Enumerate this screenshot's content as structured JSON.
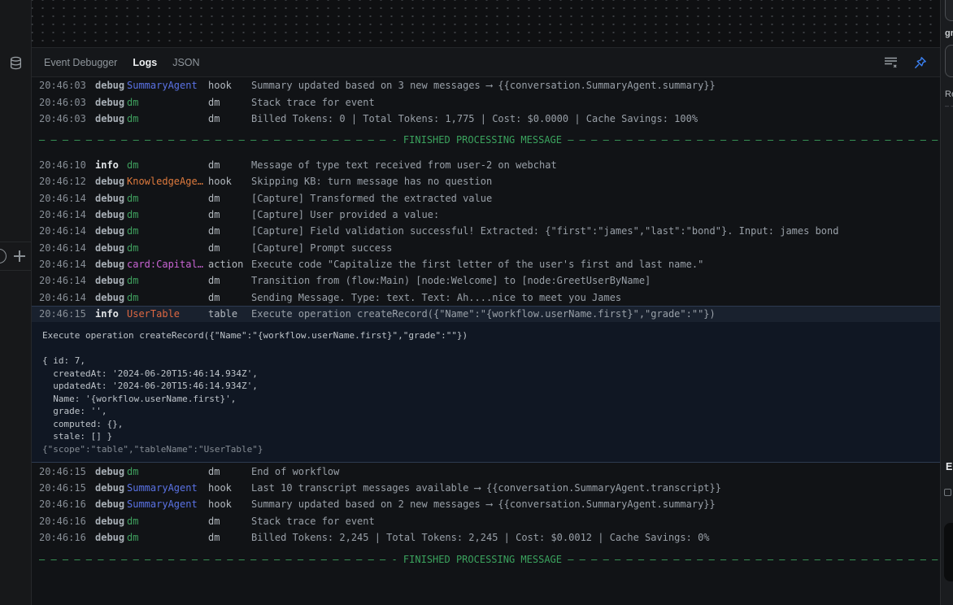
{
  "tabs": [
    {
      "id": "event-debugger",
      "label": "Event Debugger",
      "active": false
    },
    {
      "id": "logs",
      "label": "Logs",
      "active": true
    },
    {
      "id": "json",
      "label": "JSON",
      "active": false
    }
  ],
  "icons": {
    "database": "database-icon",
    "circle_partial": "circle-icon",
    "plus": "plus-icon",
    "clear_logs": "clear-logs-icon",
    "pin": "pin-icon"
  },
  "palette": {
    "blue": "#5a72e4",
    "green": "#3fa05e",
    "orange": "#de7a3d",
    "magenta": "#c964d4",
    "red": "#dd6742",
    "separator_green": "#3ba35e",
    "pin_blue": "#3b82f6",
    "selected_row_bg": "#19212e"
  },
  "separator": {
    "label": "FINISHED PROCESSING MESSAGE",
    "dash": "— ",
    "left_repeat": 30,
    "left_tail": "- ",
    "right_repeat": 40
  },
  "logs": {
    "rows": [
      {
        "type": "log",
        "time": "20:46:03",
        "level": "debug",
        "agent": "SummaryAgent",
        "agent_color": "blue",
        "category": "hook",
        "message": "Summary updated based on 3 new messages ⟶ {{conversation.SummaryAgent.summary}}"
      },
      {
        "type": "log",
        "time": "20:46:03",
        "level": "debug",
        "agent": "dm",
        "agent_color": "green",
        "category": "dm",
        "message": "Stack trace for event"
      },
      {
        "type": "log",
        "time": "20:46:03",
        "level": "debug",
        "agent": "dm",
        "agent_color": "green",
        "category": "dm",
        "message": "Billed Tokens: 0 | Total Tokens: 1,775 | Cost: $0.0000 | Cache Savings: 100%"
      },
      {
        "type": "gap",
        "size": "small"
      },
      {
        "type": "separator"
      },
      {
        "type": "gap",
        "size": "large"
      },
      {
        "type": "log",
        "time": "20:46:10",
        "level": "info",
        "agent": "dm",
        "agent_color": "green",
        "category": "dm",
        "message": "Message of type text received from user-2 on webchat"
      },
      {
        "type": "log",
        "time": "20:46:12",
        "level": "debug",
        "agent": "KnowledgeAge…",
        "agent_color": "orange",
        "category": "hook",
        "message": "Skipping KB: turn message has no question"
      },
      {
        "type": "log",
        "time": "20:46:14",
        "level": "debug",
        "agent": "dm",
        "agent_color": "green",
        "category": "dm",
        "message": "[Capture] Transformed the extracted value"
      },
      {
        "type": "log",
        "time": "20:46:14",
        "level": "debug",
        "agent": "dm",
        "agent_color": "green",
        "category": "dm",
        "message": "[Capture] User provided a value:"
      },
      {
        "type": "log",
        "time": "20:46:14",
        "level": "debug",
        "agent": "dm",
        "agent_color": "green",
        "category": "dm",
        "message": "[Capture] Field validation successful! Extracted: {\"first\":\"james\",\"last\":\"bond\"}. Input: james bond"
      },
      {
        "type": "log",
        "time": "20:46:14",
        "level": "debug",
        "agent": "dm",
        "agent_color": "green",
        "category": "dm",
        "message": "[Capture] Prompt success"
      },
      {
        "type": "log",
        "time": "20:46:14",
        "level": "debug",
        "agent": "card:Capital…",
        "agent_color": "magenta",
        "category": "action",
        "message": "Execute code \"Capitalize the first letter of the user's first and last name.\""
      },
      {
        "type": "log",
        "time": "20:46:14",
        "level": "debug",
        "agent": "dm",
        "agent_color": "green",
        "category": "dm",
        "message": "Transition from (flow:Main) [node:Welcome] to [node:GreetUserByName]"
      },
      {
        "type": "log",
        "time": "20:46:14",
        "level": "debug",
        "agent": "dm",
        "agent_color": "green",
        "category": "dm",
        "message": "Sending Message. Type: text. Text: Ah....nice to meet you James"
      },
      {
        "type": "log",
        "selected": true,
        "time": "20:46:15",
        "level": "info",
        "agent": "UserTable",
        "agent_color": "red",
        "category": "table",
        "message": "Execute operation createRecord({\"Name\":\"{workflow.userName.first}\",\"grade\":\"\"})"
      },
      {
        "type": "expanded"
      },
      {
        "type": "log",
        "time": "20:46:15",
        "level": "debug",
        "agent": "dm",
        "agent_color": "green",
        "category": "dm",
        "message": "End of workflow"
      },
      {
        "type": "log",
        "time": "20:46:15",
        "level": "debug",
        "agent": "SummaryAgent",
        "agent_color": "blue",
        "category": "hook",
        "message": "Last 10 transcript messages available ⟶ {{conversation.SummaryAgent.transcript}}"
      },
      {
        "type": "log",
        "time": "20:46:16",
        "level": "debug",
        "agent": "SummaryAgent",
        "agent_color": "blue",
        "category": "hook",
        "message": "Summary updated based on 2 new messages ⟶ {{conversation.SummaryAgent.summary}}"
      },
      {
        "type": "log",
        "time": "20:46:16",
        "level": "debug",
        "agent": "dm",
        "agent_color": "green",
        "category": "dm",
        "message": "Stack trace for event"
      },
      {
        "type": "log",
        "time": "20:46:16",
        "level": "debug",
        "agent": "dm",
        "agent_color": "green",
        "category": "dm",
        "message": "Billed Tokens: 2,245 | Total Tokens: 2,245 | Cost: $0.0012 | Cache Savings: 0%"
      },
      {
        "type": "gap",
        "size": "small"
      },
      {
        "type": "separator"
      }
    ]
  },
  "expanded": {
    "lines": [
      "Execute operation createRecord({\"Name\":\"{workflow.userName.first}\",\"grade\":\"\"})",
      "",
      "{ id: 7,",
      "  createdAt: '2024-06-20T15:46:14.934Z',",
      "  updatedAt: '2024-06-20T15:46:14.934Z',",
      "  Name: '{workflow.userName.first}',",
      "  grade: '',",
      "  computed: {},",
      "  stale: [] }",
      ""
    ],
    "meta": "{\"scope\":\"table\",\"tableName\":\"UserTable\"}"
  },
  "right_panel": {
    "top_label": "gr",
    "mid_label": "Re",
    "mid_dashes": "– –",
    "section_label": "E"
  }
}
